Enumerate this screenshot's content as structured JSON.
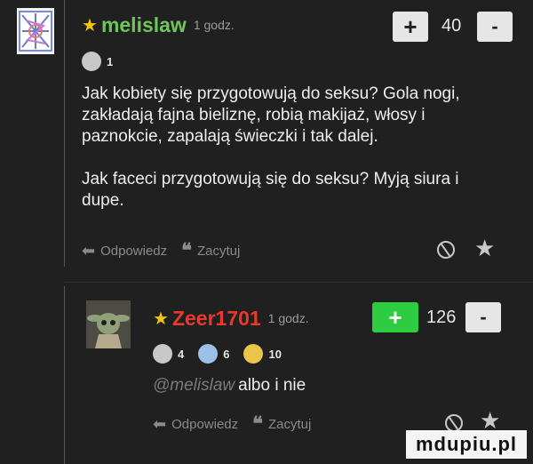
{
  "comments": [
    {
      "username": "melislaw",
      "time": "1 godz.",
      "score": "40",
      "plus": "+",
      "minus": "-",
      "medals": [
        {
          "count": "1",
          "color": "#c8c8c8"
        }
      ],
      "paragraphs": [
        "Jak kobiety się przygotowują do seksu? Gola nogi, zakładają fajna bieliznę, robią makijaż, włosy i paznokcie, zapalają świeczki i tak dalej.",
        "Jak faceci przygotowują się do seksu? Myją siura i dupe."
      ],
      "reply_label": "Odpowiedz",
      "quote_label": "Zacytuj",
      "colors": {
        "username": "#6ec65a",
        "plus_button": "#e6e6e6"
      }
    },
    {
      "username": "Zeer1701",
      "time": "1 godz.",
      "score": "126",
      "plus": "+",
      "minus": "-",
      "medals": [
        {
          "count": "4",
          "color": "#c8c8c8"
        },
        {
          "count": "6",
          "color": "#9cc1e6"
        },
        {
          "count": "10",
          "color": "#e9c54a"
        }
      ],
      "mention": "@melislaw",
      "text": "albo i nie",
      "reply_label": "Odpowiedz",
      "quote_label": "Zacytuj",
      "colors": {
        "username": "#e8392d",
        "plus_button": "#2ecc40"
      }
    }
  ],
  "watermark": "mdupiu.pl",
  "icons": [
    "reply-arrow-icon",
    "quote-icon",
    "hide-icon",
    "favorite-star-icon",
    "medal-icon"
  ]
}
